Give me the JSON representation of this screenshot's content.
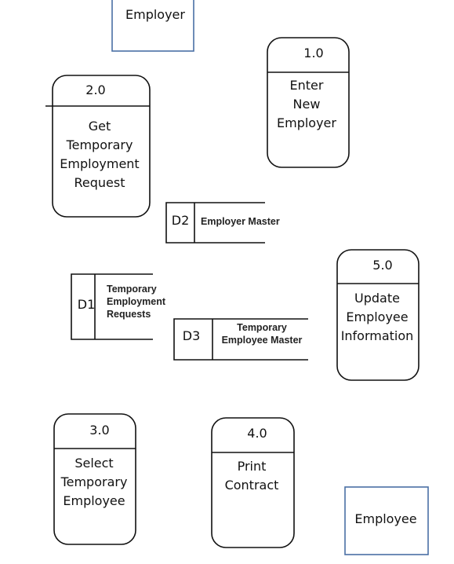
{
  "colors": {
    "external_entity_border": "#4a6fa5",
    "line": "#111111"
  },
  "external_entities": [
    {
      "label": "Employer"
    },
    {
      "label": "Employee"
    }
  ],
  "processes": [
    {
      "id": "1.0",
      "lines": [
        "Enter",
        "New",
        "Employer"
      ]
    },
    {
      "id": "2.0",
      "lines": [
        "Get",
        "Temporary",
        "Employment",
        "Request"
      ]
    },
    {
      "id": "3.0",
      "lines": [
        "Select",
        "Temporary",
        "Employee"
      ]
    },
    {
      "id": "4.0",
      "lines": [
        "Print",
        "Contract"
      ]
    },
    {
      "id": "5.0",
      "lines": [
        "Update",
        "Employee",
        "Information"
      ]
    }
  ],
  "data_stores": [
    {
      "id": "D1",
      "lines": [
        "Temporary",
        "Employment",
        "Requests"
      ]
    },
    {
      "id": "D2",
      "lines": [
        "Employer Master"
      ]
    },
    {
      "id": "D3",
      "lines": [
        "Temporary",
        "Employee Master"
      ]
    }
  ]
}
